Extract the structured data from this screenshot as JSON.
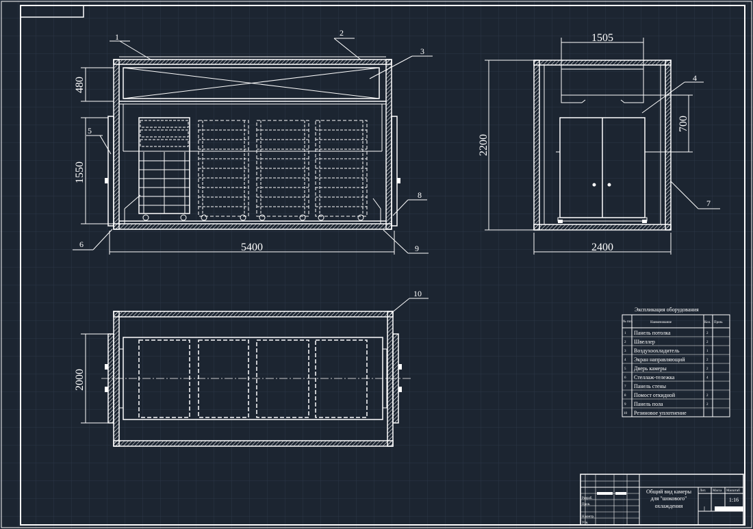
{
  "dimensions": {
    "front_width": "5400",
    "front_top_height": "480",
    "front_door_height": "1550",
    "side_width": "1505",
    "side_height": "2200",
    "side_cooler_height": "700",
    "side_total_width": "2400",
    "plan_depth": "2000"
  },
  "callouts": [
    "1",
    "2",
    "3",
    "4",
    "5",
    "6",
    "7",
    "8",
    "9",
    "10"
  ],
  "equipment_table": {
    "title": "Экспликация оборудования",
    "col_no": "№ поз.",
    "col_name": "Наименование",
    "col_qty": "Кол.",
    "col_note": "Прим.",
    "rows": [
      {
        "no": "1",
        "name": "Панель потолка",
        "qty": "2"
      },
      {
        "no": "2",
        "name": "Швеллер",
        "qty": "2"
      },
      {
        "no": "3",
        "name": "Воздухоохладитель",
        "qty": "1"
      },
      {
        "no": "4",
        "name": "Экран направляющий",
        "qty": "2"
      },
      {
        "no": "5",
        "name": "Дверь камеры",
        "qty": "2"
      },
      {
        "no": "6",
        "name": "Стеллаж-тележка",
        "qty": "4"
      },
      {
        "no": "7",
        "name": "Панель стены",
        "qty": ""
      },
      {
        "no": "8",
        "name": "Помост откидной",
        "qty": "2"
      },
      {
        "no": "9",
        "name": "Панель пола",
        "qty": "2"
      },
      {
        "no": "10",
        "name": "Резиновое уплотнение",
        "qty": ""
      }
    ]
  },
  "title_block": {
    "line1": "Общий вид камеры",
    "line2": "для \"шокового\"",
    "line3": "охлаждения",
    "scale": "1:16",
    "h_lit": "Лит.",
    "h_mass": "Масса",
    "h_scale": "Масштаб",
    "rows": [
      "Разраб.",
      "Пров.",
      "Н.контр.",
      "Утв."
    ]
  }
}
